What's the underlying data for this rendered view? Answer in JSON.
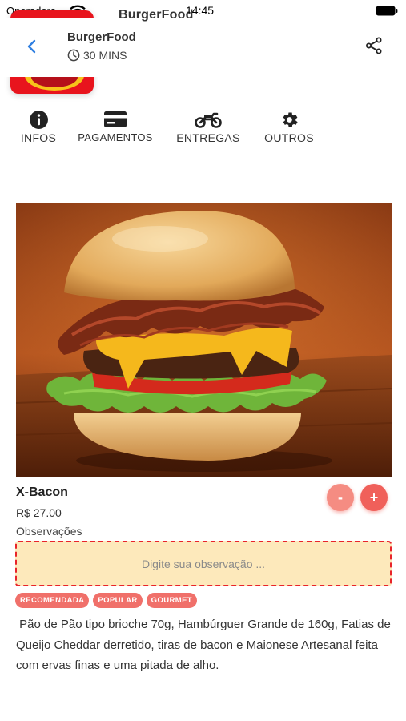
{
  "status_bar": {
    "carrier": "Operadora",
    "app_title": "BurgerFood",
    "time": "14:45"
  },
  "header": {
    "restaurant_name": "BurgerFood",
    "delivery_time": "30 MINS"
  },
  "tabs": [
    {
      "label": "INFOS",
      "icon": "info-circle-icon"
    },
    {
      "label": "PAGAMENTOS",
      "icon": "credit-card-icon"
    },
    {
      "label": "ENTREGAS",
      "icon": "motorcycle-icon"
    },
    {
      "label": "OUTROS",
      "icon": "gear-icon"
    }
  ],
  "product": {
    "name": "X-Bacon",
    "price": "R$ 27.00",
    "observations_label": "Observações",
    "observations_placeholder": "Digite sua observação ...",
    "tags": [
      "RECOMENDADA",
      "POPULAR",
      "GOURMET"
    ],
    "description": " Pão de Pão tipo brioche 70g, Hambúrguer Grande de 160g, Fatias de Queijo Cheddar derretido, tiras de bacon e Maionese Artesanal feita com ervas finas e uma pitada de alho."
  },
  "quantity_controls": {
    "minus": "-",
    "plus": "+"
  },
  "colors": {
    "accent": "#f0605a",
    "back_arrow": "#2f7fe0",
    "observation_bg": "#fde9bb",
    "observation_border": "#e8242a"
  }
}
